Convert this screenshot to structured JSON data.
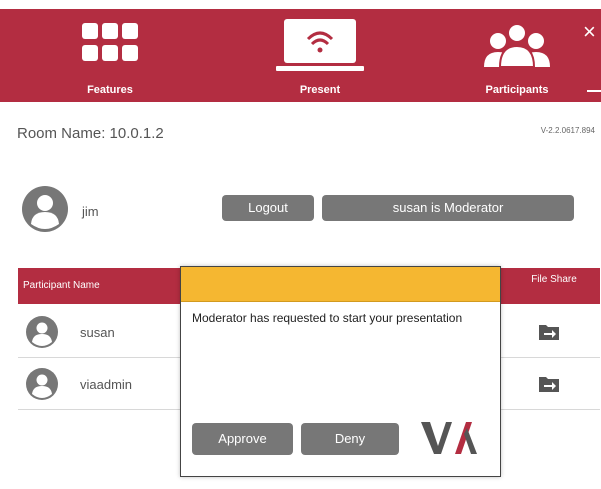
{
  "nav": {
    "features_label": "Features",
    "present_label": "Present",
    "participants_label": "Participants",
    "close_glyph": "×"
  },
  "room": {
    "name": "Room Name: 10.0.1.2",
    "version": "V-2.2.0617.894"
  },
  "user": {
    "name": "jim",
    "logout_label": "Logout",
    "moderator_label": "susan is Moderator"
  },
  "table": {
    "headers": {
      "name": "Participant Name",
      "file_share": "File Share"
    },
    "rows": [
      {
        "name": "susan",
        "icon": "file-share-icon"
      },
      {
        "name": "viaadmin",
        "icon": "file-share-icon"
      }
    ]
  },
  "modal": {
    "message": "Moderator has requested to start your presentation",
    "approve_label": "Approve",
    "deny_label": "Deny",
    "logo_text": "VIA"
  },
  "colors": {
    "brand_red": "#b32d41",
    "modal_header": "#f5b731",
    "button_gray": "#777777"
  },
  "icons": [
    "features-grid-icon",
    "present-laptop-wifi-icon",
    "participants-group-icon",
    "close-icon",
    "minimize-icon",
    "avatar-icon",
    "file-share-icon"
  ]
}
